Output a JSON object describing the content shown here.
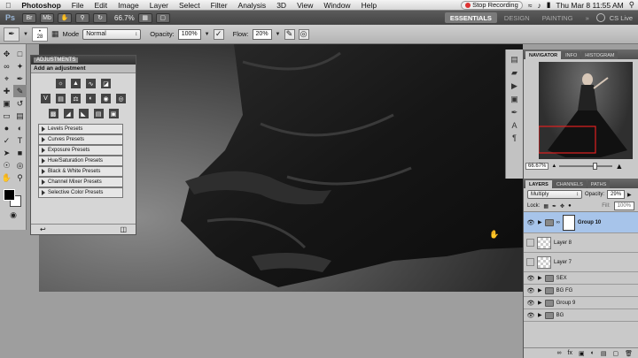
{
  "menubar": {
    "items": [
      "Photoshop",
      "File",
      "Edit",
      "Image",
      "Layer",
      "Select",
      "Filter",
      "Analysis",
      "3D",
      "View",
      "Window",
      "Help"
    ],
    "stop_recording": "Stop Recording",
    "clock": "Thu Mar 8  11:55 AM"
  },
  "appbar": {
    "logo": "Ps",
    "zoom": "66.7%",
    "workspaces": [
      "ESSENTIALS",
      "DESIGN",
      "PAINTING"
    ],
    "cslive": "CS Live"
  },
  "options": {
    "brush_size": "28",
    "mode_label": "Mode",
    "mode_value": "Normal",
    "opacity_label": "Opacity:",
    "opacity_value": "100%",
    "flow_label": "Flow:",
    "flow_value": "20%"
  },
  "adjustments": {
    "tab": "ADJUSTMENTS",
    "header": "Add an adjustment",
    "presets": [
      "Levels Presets",
      "Curves Presets",
      "Exposure Presets",
      "Hue/Saturation Presets",
      "Black & White Presets",
      "Channel Mixer Presets",
      "Selective Color Presets"
    ]
  },
  "navigator": {
    "tabs": [
      "NAVIGATOR",
      "INFO",
      "HISTOGRAM"
    ],
    "zoom": "66.67%"
  },
  "layers": {
    "tabs": [
      "LAYERS",
      "CHANNELS",
      "PATHS"
    ],
    "blend_mode": "Multiply",
    "opacity_label": "Opacity:",
    "opacity_value": "29%",
    "lock_label": "Lock:",
    "fill_label": "Fill:",
    "fill_value": "100%",
    "items": [
      {
        "name": "Group 10",
        "type": "group",
        "selected": true
      },
      {
        "name": "Layer 8",
        "type": "layer",
        "selected": false
      },
      {
        "name": "Layer 7",
        "type": "layer",
        "selected": false
      },
      {
        "name": "SEX",
        "type": "group",
        "selected": false
      },
      {
        "name": "BG FG",
        "type": "group",
        "selected": false
      },
      {
        "name": "Group 9",
        "type": "group",
        "selected": false
      },
      {
        "name": "BG",
        "type": "group",
        "selected": false
      }
    ]
  }
}
